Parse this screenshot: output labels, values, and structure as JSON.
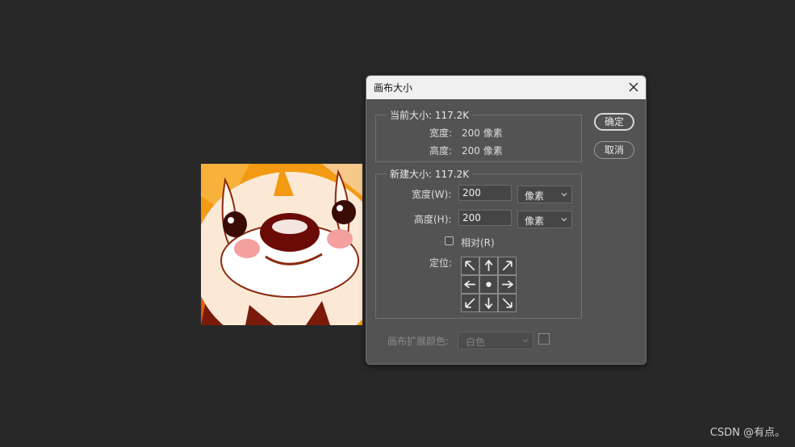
{
  "dialog": {
    "title": "画布大小",
    "current_size": {
      "legend": "当前大小: 117.2K",
      "width_label": "宽度:",
      "width_value": "200 像素",
      "height_label": "高度:",
      "height_value": "200 像素"
    },
    "new_size": {
      "legend": "新建大小: 117.2K",
      "width_label": "宽度(W):",
      "width_value": "200",
      "width_unit": "像素",
      "height_label": "高度(H):",
      "height_value": "200",
      "height_unit": "像素",
      "relative_label": "相对(R)",
      "relative_checked": false,
      "anchor_label": "定位:"
    },
    "canvas_extension_color_label": "画布扩展颜色:",
    "canvas_extension_color_value": "白色",
    "ok_label": "确定",
    "cancel_label": "取消"
  },
  "watermark": "CSDN @有点。",
  "colors": {
    "workspace_bg": "#282828",
    "dialog_bg": "#535353",
    "titlebar_bg": "#f0f0f0",
    "tiger_orange": "#f08a10"
  }
}
